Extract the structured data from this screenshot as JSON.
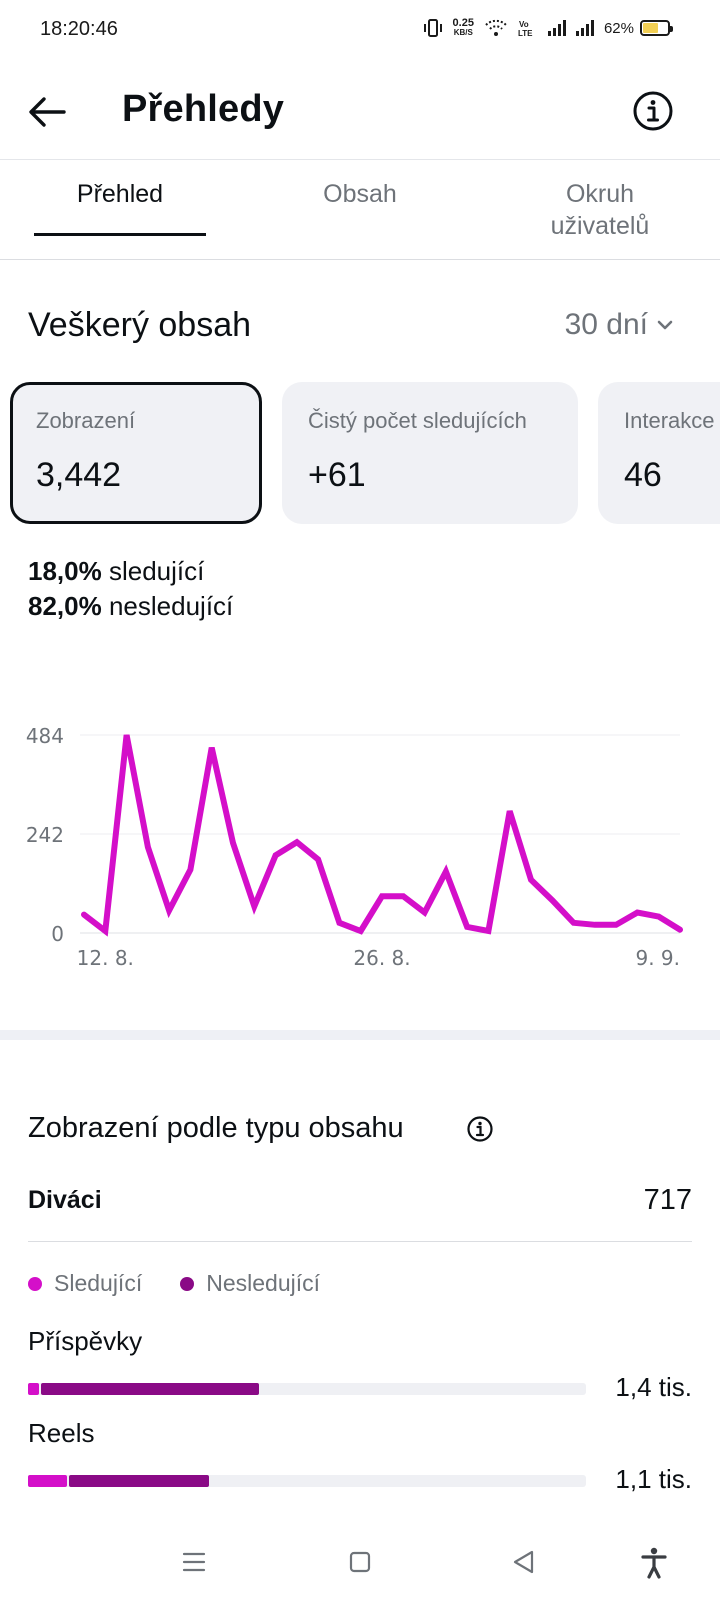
{
  "status": {
    "time": "18:20:46",
    "net_speed_value": "0.25",
    "net_speed_unit": "KB/S",
    "volte": "Vo LTE",
    "battery": "62%",
    "battery_level": 0.62
  },
  "header": {
    "title": "Přehledy",
    "back_icon": "arrow-left-icon",
    "info_icon": "info-circle-icon"
  },
  "tabs": [
    {
      "label": "Přehled",
      "active": true
    },
    {
      "label": "Obsah",
      "active": false
    },
    {
      "label": "Okruh uživatelů",
      "active": false
    }
  ],
  "section": {
    "title": "Veškerý obsah",
    "range": "30 dní"
  },
  "cards": [
    {
      "label": "Zobrazení",
      "value": "3,442",
      "selected": true
    },
    {
      "label": "Čistý počet sledujících",
      "value": "+61",
      "selected": false
    },
    {
      "label": "Interakce",
      "value": "46",
      "selected": false
    }
  ],
  "split": {
    "followers_pct": "18,0%",
    "followers_label": "sledující",
    "nonfollowers_pct": "82,0%",
    "nonfollowers_label": "nesledující"
  },
  "chart_data": {
    "type": "line",
    "color": "#d40fc9",
    "ylim": [
      0,
      484
    ],
    "yticks": [
      "0",
      "242",
      "484"
    ],
    "xticks": [
      {
        "label": "12. 8.",
        "index": 1
      },
      {
        "label": "26. 8.",
        "index": 14
      },
      {
        "label": "9. 9.",
        "index": 28
      }
    ],
    "values": [
      45,
      5,
      484,
      210,
      55,
      155,
      453,
      220,
      65,
      190,
      222,
      180,
      25,
      5,
      90,
      90,
      50,
      150,
      15,
      5,
      298,
      130,
      80,
      25,
      20,
      20,
      50,
      40,
      8
    ]
  },
  "breakdown": {
    "title": "Zobrazení podle typu obsahu",
    "info_icon": "info-circle-icon",
    "viewers_label": "Diváci",
    "viewers_value": "717",
    "legend": [
      {
        "label": "Sledující",
        "color": "#d40fc9"
      },
      {
        "label": "Nesledující",
        "color": "#8a0a86"
      }
    ],
    "rows": [
      {
        "label": "Příspěvky",
        "value": "1,4 tis.",
        "followers_share": 0.02,
        "nonfollowers_share": 0.39
      },
      {
        "label": "Reels",
        "value": "1,1 tis.",
        "followers_share": 0.07,
        "nonfollowers_share": 0.25
      }
    ]
  },
  "navbar": [
    "menu-icon",
    "home-square-icon",
    "back-triangle-icon",
    "accessibility-icon"
  ]
}
